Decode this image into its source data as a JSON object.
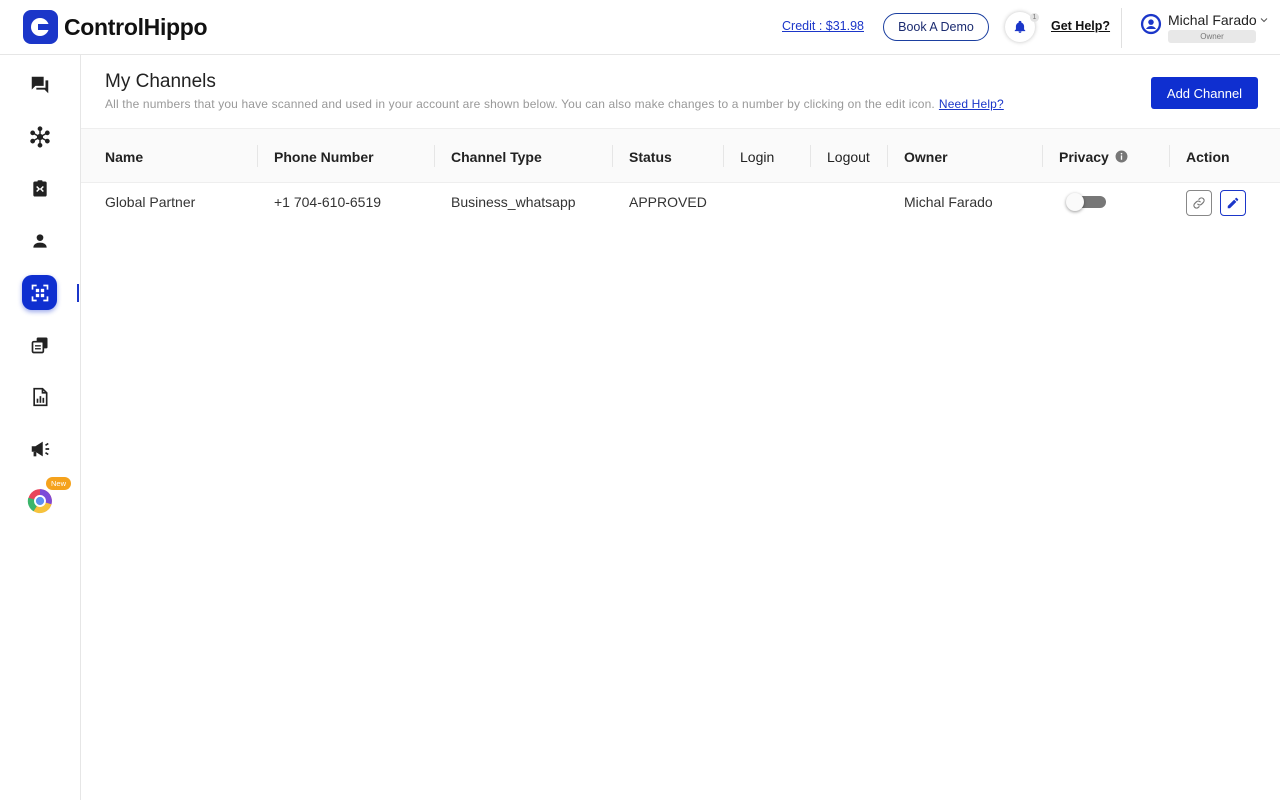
{
  "brand": {
    "name": "ControlHippo",
    "accent": "#0f2fd0"
  },
  "header": {
    "credit": "Credit : $31.98",
    "book_demo": "Book A Demo",
    "notification_count": "1",
    "get_help": "Get Help?",
    "user": {
      "name": "Michal Farado",
      "role": "Owner"
    }
  },
  "sidebar": {
    "items": [
      {
        "icon": "chat-icon"
      },
      {
        "icon": "integrations-icon"
      },
      {
        "icon": "contacts-card-icon"
      },
      {
        "icon": "user-icon"
      },
      {
        "icon": "qr-scan-icon",
        "active": true
      },
      {
        "icon": "templates-icon"
      },
      {
        "icon": "reports-icon"
      },
      {
        "icon": "broadcast-icon"
      },
      {
        "icon": "chrome-extension-icon",
        "badge": "New"
      }
    ]
  },
  "main": {
    "title": "My Channels",
    "subtitle": "All the numbers that you have scanned and used in your account are shown below. You can also make changes to a number by clicking on the edit icon.",
    "need_help": "Need Help?",
    "add_channel": "Add Channel",
    "columns": [
      "Name",
      "Phone Number",
      "Channel Type",
      "Status",
      "Login",
      "Logout",
      "Owner",
      "Privacy",
      "Action"
    ],
    "rows": [
      {
        "name": "Global Partner",
        "phone": "+1 704-610-6519",
        "channel_type": "Business_whatsapp",
        "status": "APPROVED",
        "login": "",
        "logout": "",
        "owner": "Michal Farado",
        "privacy_enabled": false
      }
    ]
  }
}
